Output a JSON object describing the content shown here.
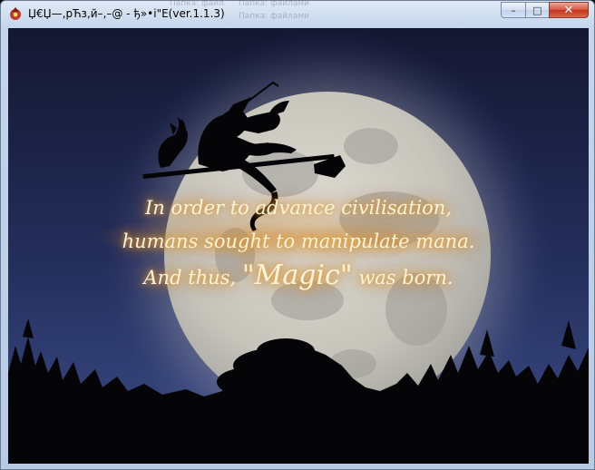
{
  "window": {
    "title": "Џ€Џ—‚рЋз‚й–‚–@ - ђ»•i\"E(ver.1.1.3)",
    "ghost_left": "Папка: файл",
    "ghost_right1": "Папка: файлами",
    "ghost_right2": "Папка: файлами",
    "controls": {
      "minimize": "–",
      "maximize": "□",
      "close": "✕"
    }
  },
  "scene": {
    "line1": "In order to advance civilisation,",
    "line2": "humans sought to manipulate mana.",
    "line3_prefix": "And thus, ",
    "line3_magic": "\"Magic\"",
    "line3_suffix": " was born.",
    "colors": {
      "sky_top": "#141731",
      "sky_bottom": "#3b4c88",
      "moon": "#cfcdc5",
      "text_glow": "#e9a63a",
      "silhouette": "#050507"
    }
  }
}
